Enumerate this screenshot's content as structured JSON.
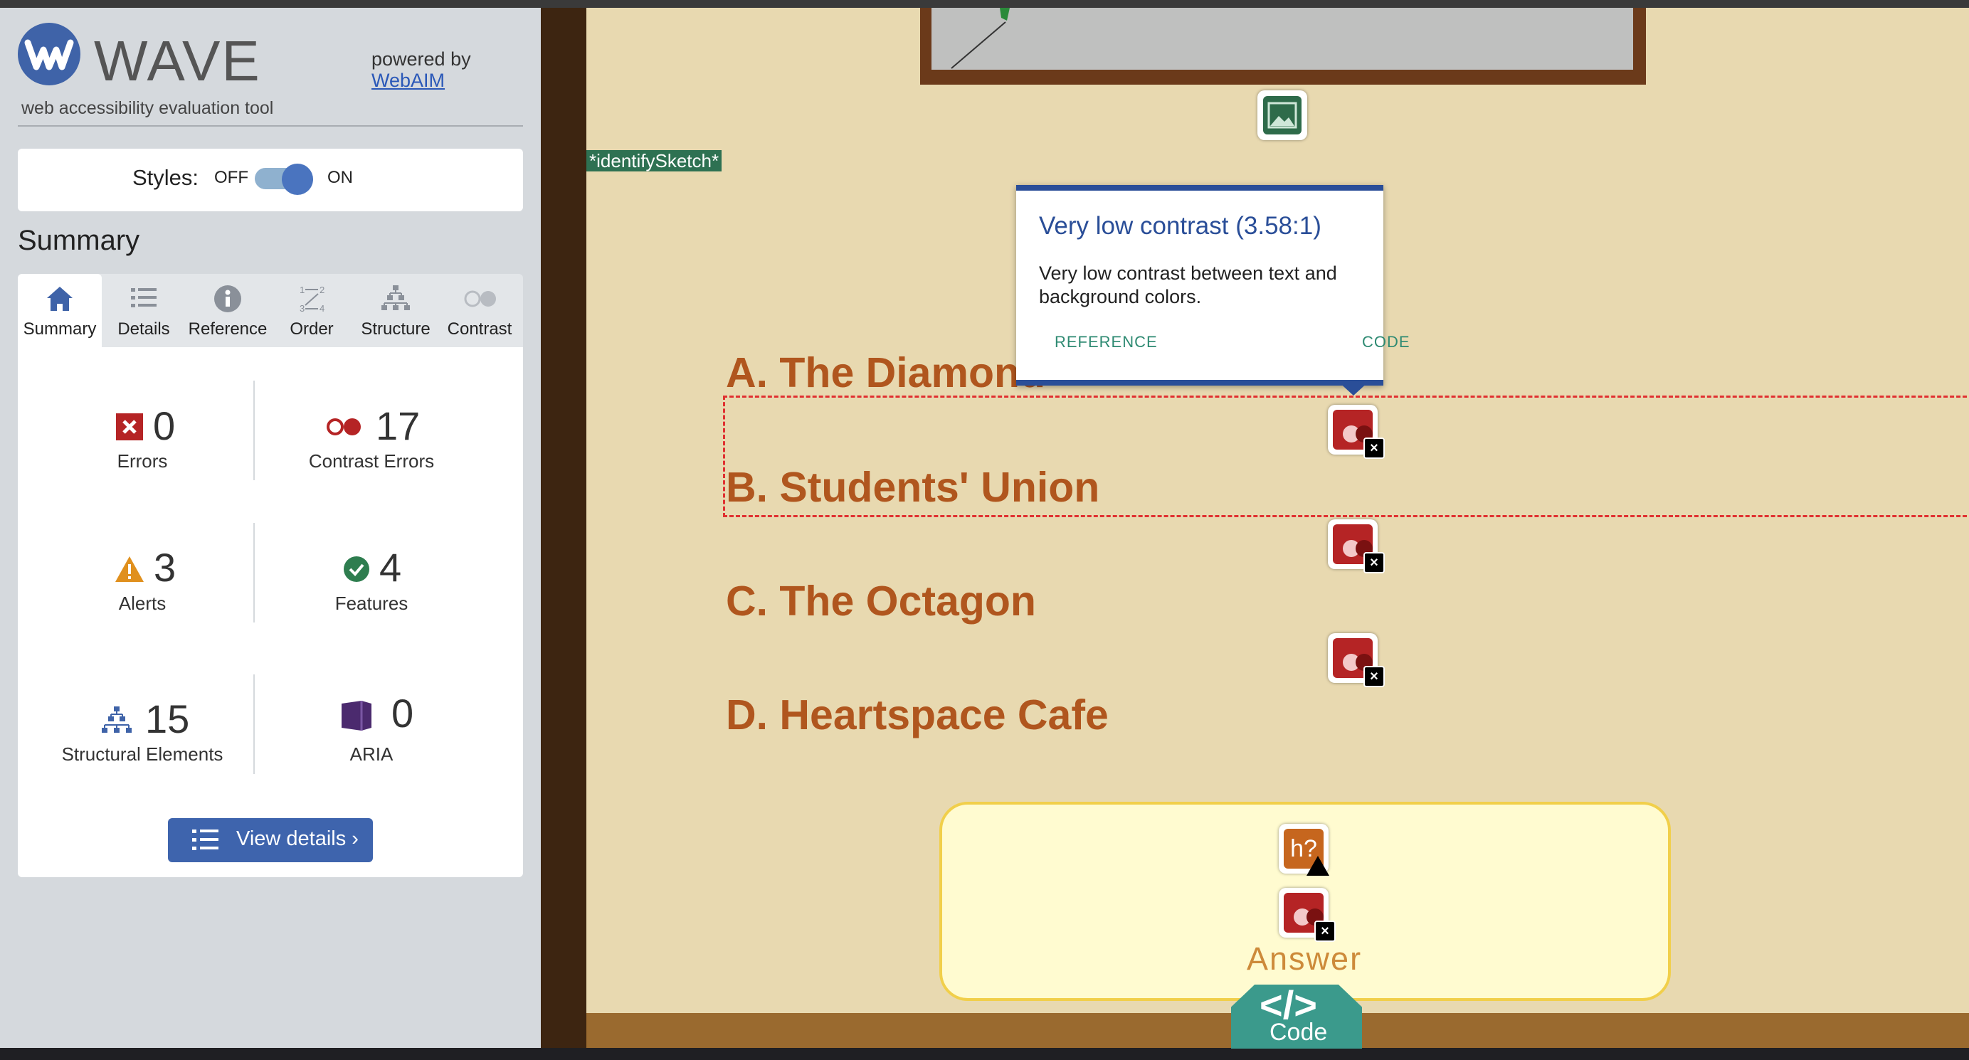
{
  "wave": {
    "brand": "WAVE",
    "tagline": "web accessibility evaluation tool",
    "powered_by": "powered by",
    "webaim_link": "WebAIM",
    "styles_label": "Styles:",
    "styles_off": "OFF",
    "styles_on": "ON",
    "styles_enabled": true,
    "summary_heading": "Summary",
    "tabs": [
      {
        "label": "Summary",
        "icon": "home-icon",
        "active": true
      },
      {
        "label": "Details",
        "icon": "list-icon"
      },
      {
        "label": "Reference",
        "icon": "info-icon"
      },
      {
        "label": "Order",
        "icon": "order-icon"
      },
      {
        "label": "Structure",
        "icon": "hierarchy-icon"
      },
      {
        "label": "Contrast",
        "icon": "contrast-icon"
      }
    ],
    "stats": {
      "errors": {
        "count": "0",
        "label": "Errors"
      },
      "contrast_errors": {
        "count": "17",
        "label": "Contrast Errors"
      },
      "alerts": {
        "count": "3",
        "label": "Alerts"
      },
      "features": {
        "count": "4",
        "label": "Features"
      },
      "structural": {
        "count": "15",
        "label": "Structural Elements"
      },
      "aria": {
        "count": "0",
        "label": "ARIA"
      }
    },
    "view_details_label": "View details ›"
  },
  "page": {
    "sketch_tag": "*identifySketch*",
    "options": [
      "A. The Diamond",
      "B. Students' Union",
      "C. The Octagon",
      "D. Heartspace Cafe"
    ],
    "answer_label": "Answer",
    "code_symbol": "</>",
    "code_label": "Code",
    "alert_badge_text": "h?"
  },
  "tooltip": {
    "title": "Very low contrast (3.58:1)",
    "body": "Very low contrast between text and background colors.",
    "reference": "REFERENCE",
    "code": "CODE"
  },
  "colors": {
    "wave_blue": "#3f63a8",
    "error_red": "#b52425",
    "alert_orange": "#e0901e",
    "feature_green": "#2e7d4f",
    "aria_purple": "#4b2a6e",
    "option_text": "#b0561e",
    "page_bg": "#e8d9b0"
  }
}
